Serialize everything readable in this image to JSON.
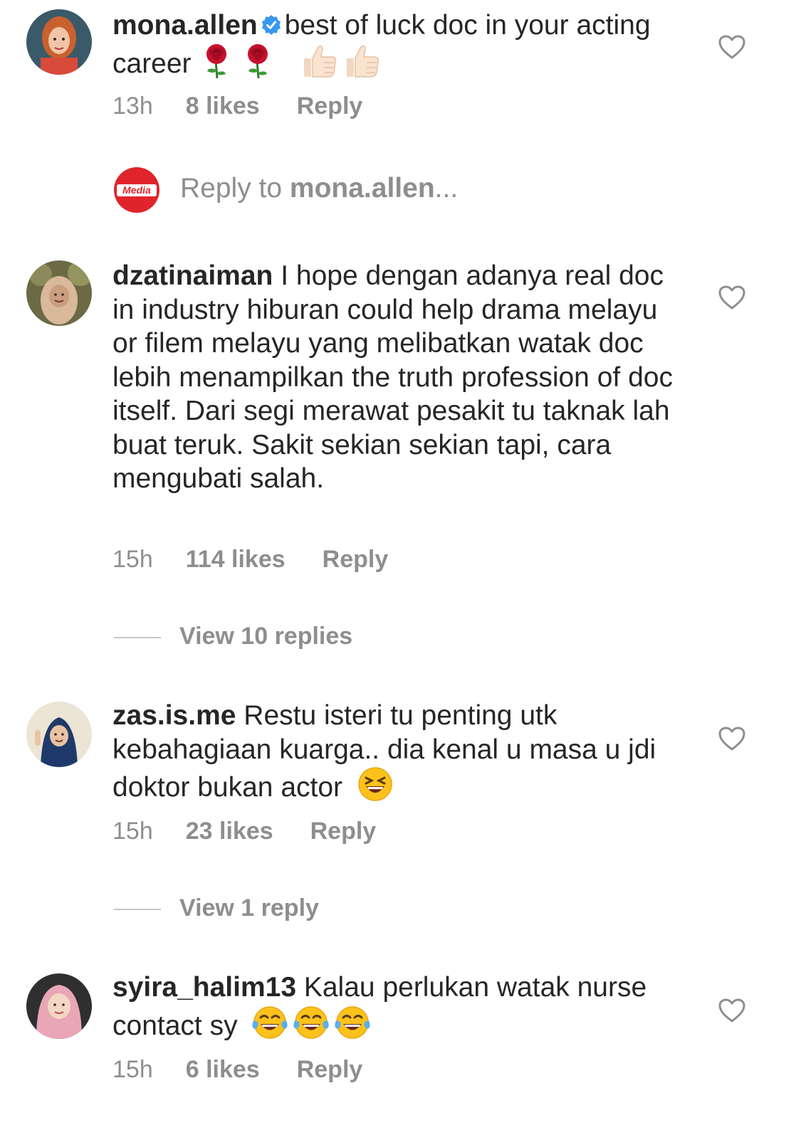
{
  "colors": {
    "text_primary": "#262626",
    "text_secondary": "#8e8e8e",
    "verified_blue": "#3897f0",
    "media_red": "#e0242b"
  },
  "comments": [
    {
      "username": "mona.allen",
      "verified": true,
      "text": "best of luck doc in your acting career",
      "emojis": [
        "rose-emoji",
        "rose-emoji",
        "thumbs-up-emoji",
        "thumbs-up-emoji"
      ],
      "time": "13h",
      "likes": "8 likes",
      "reply": "Reply"
    },
    {
      "username": "dzatinaiman",
      "verified": false,
      "text": "I hope dengan adanya real doc in industry hiburan could help drama melayu or filem melayu yang melibatkan watak doc lebih menampilkan the truth profession of doc itself. Dari segi merawat pesakit tu taknak lah buat teruk. Sakit sekian sekian tapi, cara mengubati salah.",
      "time": "15h",
      "likes": "114 likes",
      "reply": "Reply",
      "view_replies": "View 10 replies"
    },
    {
      "username": "zas.is.me",
      "verified": false,
      "text": "Restu isteri tu penting utk kebahagiaan kuarga.. dia kenal u masa u jdi doktor bukan  actor",
      "emojis": [
        "grinning-squinting-emoji"
      ],
      "time": "15h",
      "likes": "23 likes",
      "reply": "Reply",
      "view_replies": "View 1 reply"
    },
    {
      "username": "syira_halim13",
      "verified": false,
      "text": "Kalau perlukan watak nurse contact sy",
      "emojis": [
        "tears-of-joy-emoji",
        "tears-of-joy-emoji",
        "tears-of-joy-emoji"
      ],
      "time": "15h",
      "likes": "6 likes",
      "reply": "Reply"
    }
  ],
  "reply_to": {
    "prefix": "Reply to",
    "username": "mona.allen",
    "suffix": "...",
    "avatar_text": "Media"
  }
}
